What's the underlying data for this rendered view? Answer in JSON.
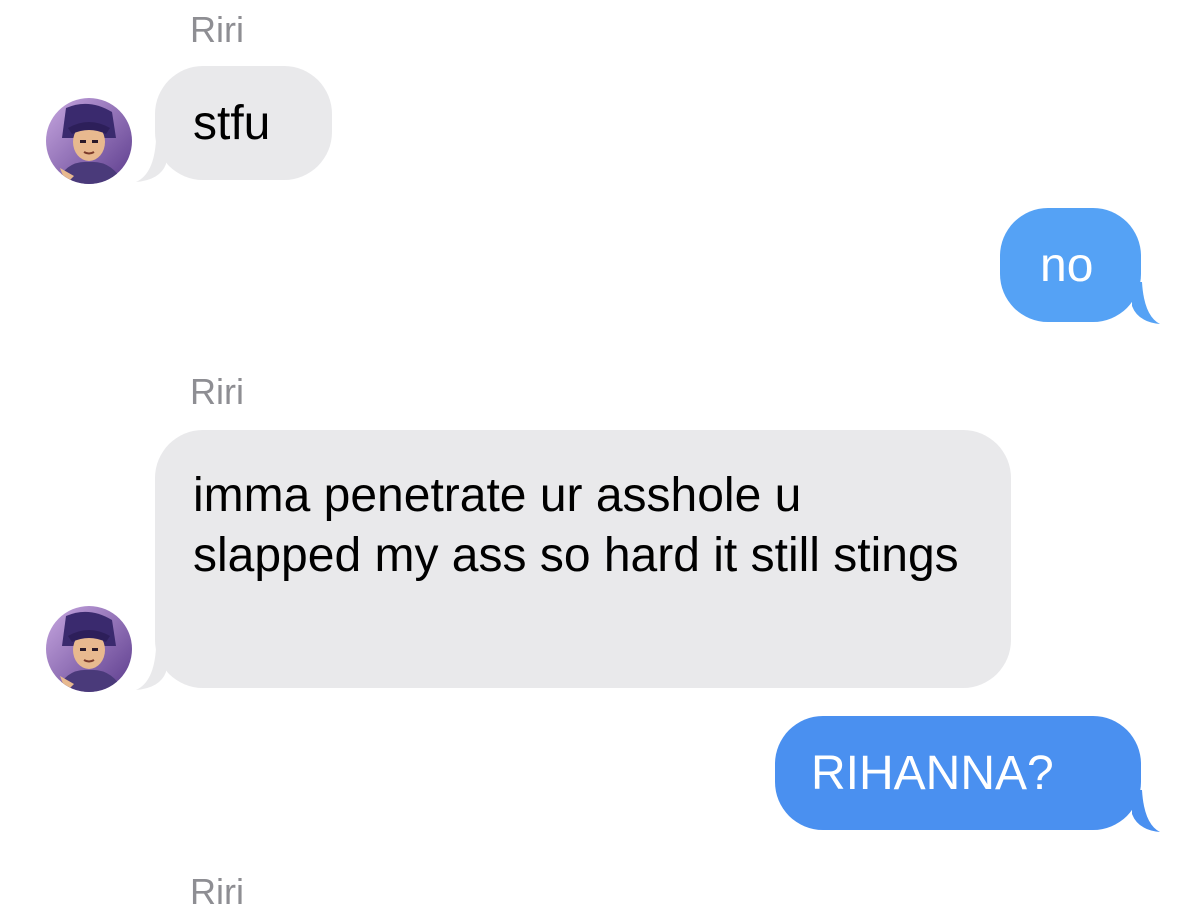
{
  "conversation": {
    "messages": [
      {
        "direction": "incoming",
        "sender": "Riri",
        "text": "stfu"
      },
      {
        "direction": "outgoing",
        "text": "no"
      },
      {
        "direction": "incoming",
        "sender": "Riri",
        "text": "imma penetrate ur asshole u slapped my ass so hard it still stings"
      },
      {
        "direction": "outgoing",
        "text": "RIHANNA?"
      },
      {
        "direction": "incoming",
        "sender": "Riri",
        "text": ""
      }
    ]
  },
  "colors": {
    "incoming_bubble": "#e9e9eb",
    "outgoing_bubble": "#55a2f5",
    "sender_name": "#8e8e93",
    "background": "#ffffff"
  },
  "icons": {
    "avatar": "anime-character-avatar"
  }
}
